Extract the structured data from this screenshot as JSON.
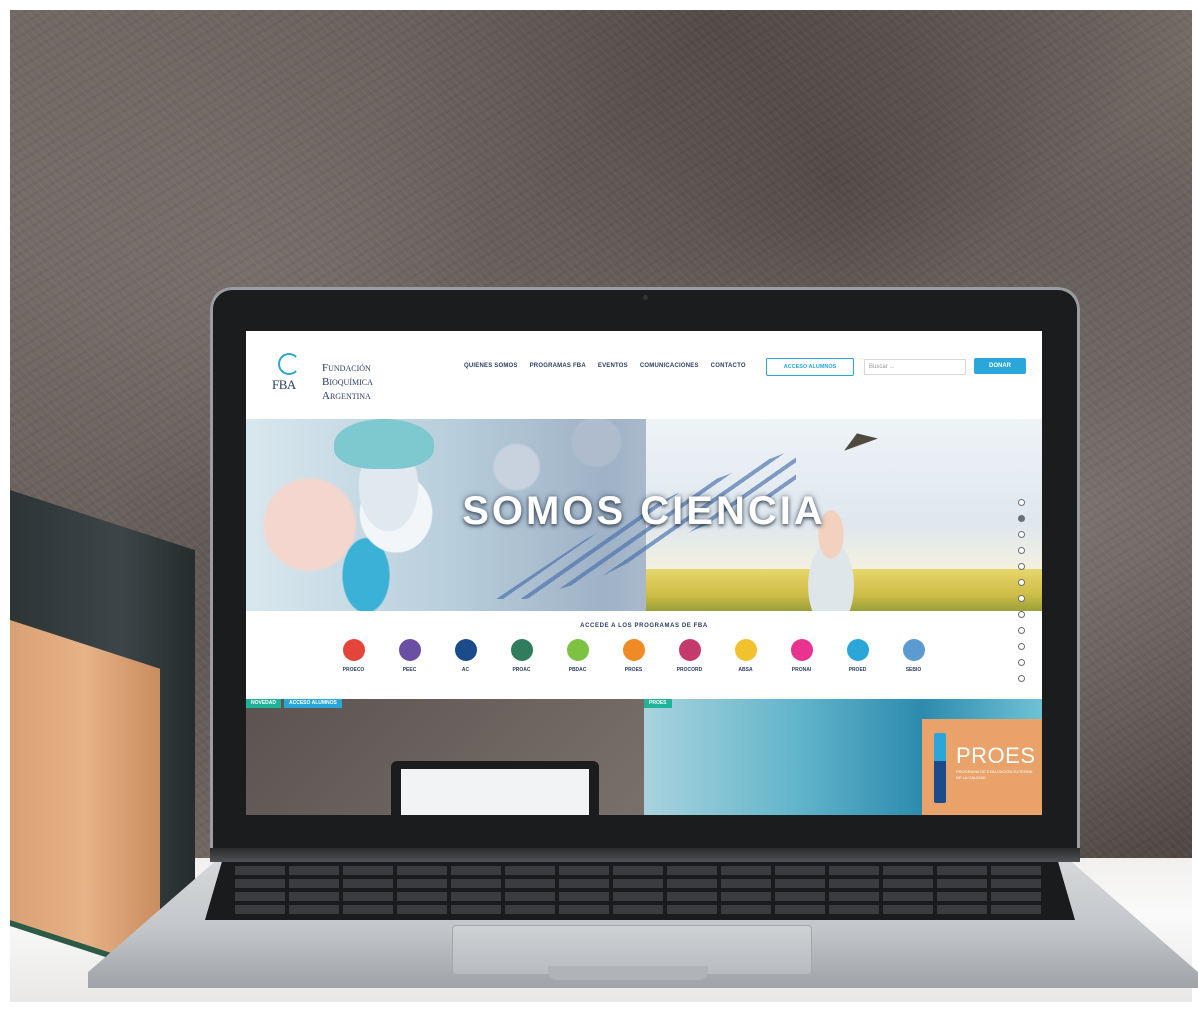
{
  "site": {
    "logo_mark": "FBA",
    "logo_lines": [
      "Fundación",
      "Bioquímica",
      "Argentina"
    ],
    "nav": [
      "QUIENES SOMOS",
      "PROGRAMAS FBA",
      "EVENTOS",
      "COMUNICACIONES",
      "CONTACTO"
    ],
    "access_button": "ACCESO ALUMNOS",
    "search_placeholder": "Buscar ...",
    "donate_button": "DONAR",
    "hero_title": "SOMOS CIENCIA",
    "programs_title": "ACCEDE A LOS PROGRAMAS DE FBA",
    "programs": [
      {
        "label": "PROECO",
        "color": "#e4453a"
      },
      {
        "label": "PEEC",
        "color": "#6a4fa3"
      },
      {
        "label": "AC",
        "color": "#1b4b8a"
      },
      {
        "label": "PROAC",
        "color": "#2f7d5d"
      },
      {
        "label": "PBDAC",
        "color": "#7cc243"
      },
      {
        "label": "PROES",
        "color": "#f08a24"
      },
      {
        "label": "PROCORD",
        "color": "#c43a6b"
      },
      {
        "label": "ABSA",
        "color": "#f2c12e"
      },
      {
        "label": "PRONAI",
        "color": "#e8348f"
      },
      {
        "label": "PROED",
        "color": "#2aa7d8"
      },
      {
        "label": "SEBIO",
        "color": "#5c9bd1"
      }
    ],
    "card_left_tags": [
      "NOVEDAD",
      "ACCESO ALUMNOS"
    ],
    "card_right_tag": "PROES",
    "proes_title": "PROES",
    "proes_sub": "PROGRAMA DE EVALUACIÓN EXTERNA DE LA CALIDAD"
  },
  "colors": {
    "accent": "#2aa7d8",
    "navy": "#2b3e63"
  }
}
